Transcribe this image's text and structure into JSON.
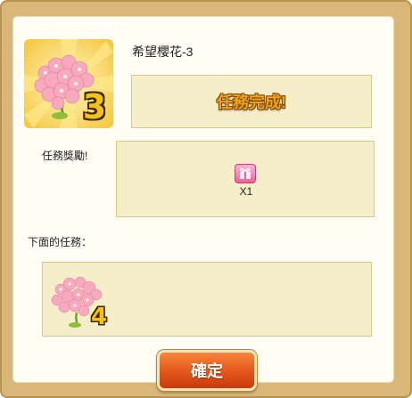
{
  "task": {
    "title": "希望櫻花-3",
    "badge_number": "3",
    "status_text": "任務完成!"
  },
  "reward": {
    "label": "任務獎勵!",
    "item_icon": "pink-gift-box-icon",
    "quantity": "X1"
  },
  "next_task": {
    "label": "下面的任務：",
    "badge_number": "4"
  },
  "confirm_button": {
    "label": "確定"
  },
  "colors": {
    "frame": "#d9b779",
    "panel": "#fffdf4",
    "box_fill": "#f6edc9",
    "box_border": "#d8c982",
    "accent_text": "#f2a21a",
    "button": "#e4551b"
  }
}
